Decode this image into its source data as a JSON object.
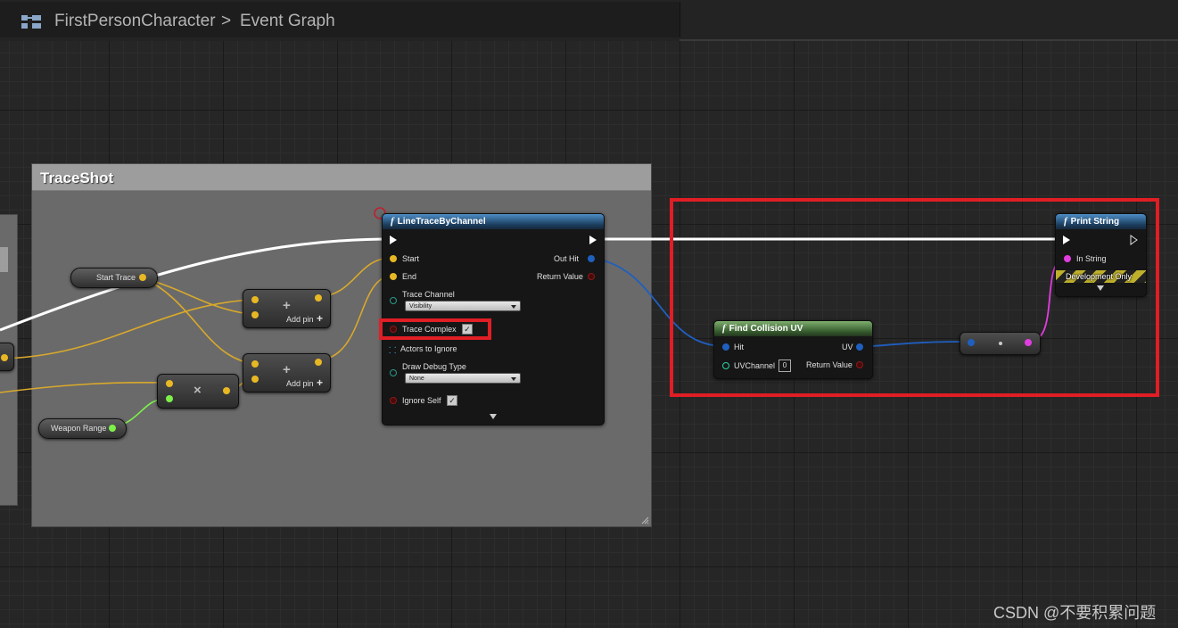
{
  "breadcrumb": {
    "blueprint": "FirstPersonCharacter",
    "separator": ">",
    "graph": "Event Graph"
  },
  "comment_box": {
    "title": "TraceShot"
  },
  "variables": {
    "start_trace": "Start Trace",
    "weapon_range": "Weapon Range"
  },
  "add_nodes": [
    {
      "glyph": "+",
      "add_pin_label": "Add pin"
    },
    {
      "glyph": "+",
      "add_pin_label": "Add pin"
    }
  ],
  "multiply_node": {
    "glyph": "×"
  },
  "line_trace": {
    "title": "LineTraceByChannel",
    "start": "Start",
    "end": "End",
    "trace_channel": "Trace Channel",
    "trace_channel_value": "Visibility",
    "trace_complex": "Trace Complex",
    "actors_to_ignore": "Actors to Ignore",
    "draw_debug_type": "Draw Debug Type",
    "draw_debug_value": "None",
    "ignore_self": "Ignore Self",
    "out_hit": "Out Hit",
    "return_value": "Return Value"
  },
  "find_uv": {
    "title": "Find Collision UV",
    "hit": "Hit",
    "uv_channel": "UVChannel",
    "uv_channel_value": "0",
    "uv": "UV",
    "return_value": "Return Value"
  },
  "print_string": {
    "title": "Print String",
    "in_string": "In String",
    "development_only": "Development Only"
  },
  "colors": {
    "exec_wire": "#ffffff",
    "float_wire": "#d9a92b",
    "struct_wire": "#1f5fbf",
    "string_wire": "#e23de0",
    "int_wire": "#7ef04a",
    "highlight": "#e01e25"
  },
  "watermark": "CSDN @不要积累问题"
}
